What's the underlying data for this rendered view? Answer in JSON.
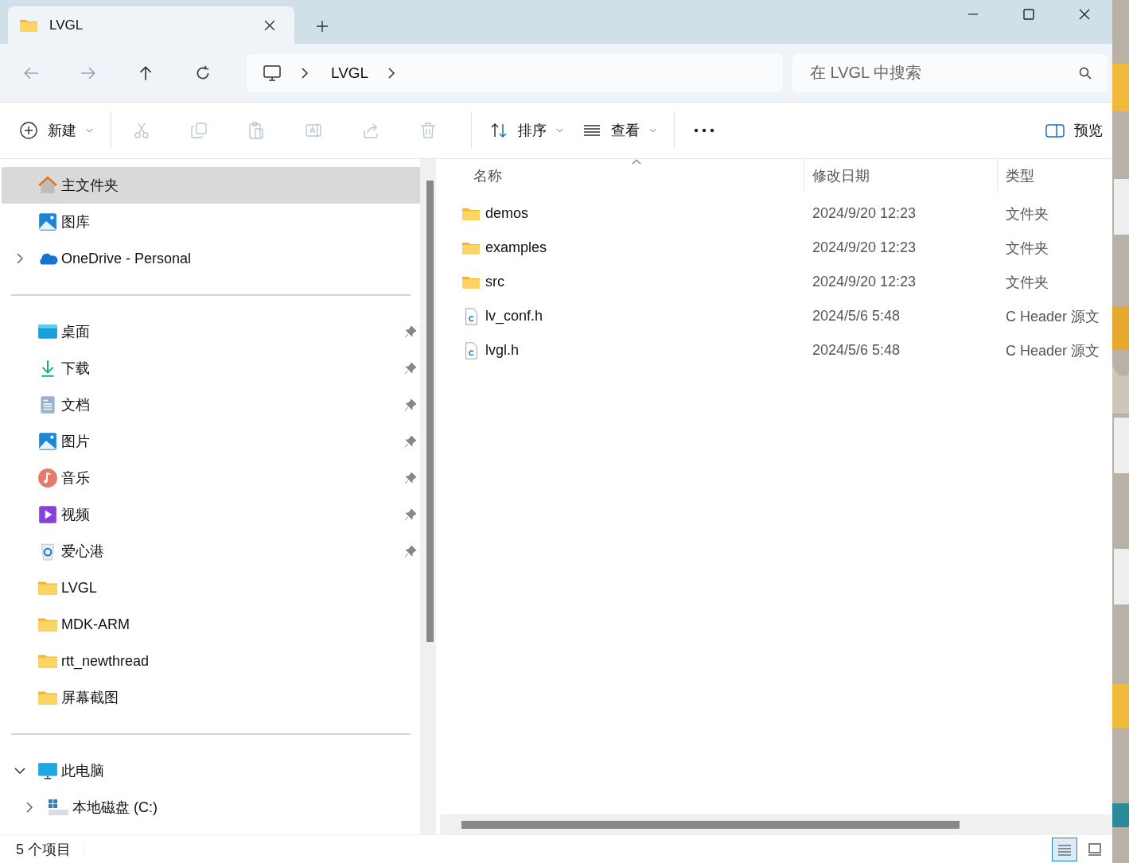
{
  "window": {
    "tab_title": "LVGL"
  },
  "address_bar": {
    "crumbs": [
      "LVGL"
    ]
  },
  "search": {
    "placeholder": "在 LVGL 中搜索"
  },
  "toolbar": {
    "new_label": "新建",
    "actions": [
      {
        "kind": "cut",
        "disabled": true
      },
      {
        "kind": "copy",
        "disabled": true
      },
      {
        "kind": "paste",
        "disabled": true
      },
      {
        "kind": "rename",
        "disabled": true
      },
      {
        "kind": "share",
        "disabled": true
      },
      {
        "kind": "delete",
        "disabled": true
      }
    ],
    "sort_label": "排序",
    "view_label": "查看",
    "preview_label": "预览"
  },
  "sidebar": {
    "groups": [
      {
        "items": [
          {
            "label": "主文件夹",
            "kind": "home",
            "selected": true,
            "pinned": false
          },
          {
            "label": "图库",
            "kind": "gallery",
            "selected": false,
            "pinned": false
          },
          {
            "label": "OneDrive - Personal",
            "kind": "cloud",
            "selected": false,
            "pinned": false,
            "expanded": false
          }
        ]
      },
      {
        "items": [
          {
            "label": "桌面",
            "kind": "desktop",
            "selected": false,
            "pinned": true
          },
          {
            "label": "下载",
            "kind": "download",
            "selected": false,
            "pinned": true
          },
          {
            "label": "文档",
            "kind": "document",
            "selected": false,
            "pinned": true
          },
          {
            "label": "图片",
            "kind": "pictures",
            "selected": false,
            "pinned": true
          },
          {
            "label": "音乐",
            "kind": "music",
            "selected": false,
            "pinned": true
          },
          {
            "label": "视频",
            "kind": "video",
            "selected": false,
            "pinned": true
          },
          {
            "label": "爱心港",
            "kind": "recycle",
            "selected": false,
            "pinned": true
          },
          {
            "label": "LVGL",
            "kind": "folder",
            "selected": false,
            "pinned": false
          },
          {
            "label": "MDK-ARM",
            "kind": "folder",
            "selected": false,
            "pinned": false
          },
          {
            "label": "rtt_newthread",
            "kind": "folder",
            "selected": false,
            "pinned": false
          },
          {
            "label": "屏幕截图",
            "kind": "folder",
            "selected": false,
            "pinned": false
          }
        ]
      },
      {
        "items": [
          {
            "label": "此电脑",
            "kind": "computer",
            "selected": false,
            "pinned": false,
            "expanded": true,
            "children": [
              {
                "label": "本地磁盘 (C:)",
                "kind": "drive",
                "selected": false,
                "pinned": false,
                "expanded": false
              }
            ]
          }
        ]
      }
    ]
  },
  "files": {
    "columns": [
      "名称",
      "修改日期",
      "类型"
    ],
    "sort_ascending": true,
    "rows": [
      {
        "name": "demos",
        "date": "2024/9/20 12:23",
        "type": "文件夹",
        "kind": "folder",
        "selected": false
      },
      {
        "name": "examples",
        "date": "2024/9/20 12:23",
        "type": "文件夹",
        "kind": "folder",
        "selected": false
      },
      {
        "name": "src",
        "date": "2024/9/20 12:23",
        "type": "文件夹",
        "kind": "folder",
        "selected": false
      },
      {
        "name": "lv_conf.h",
        "date": "2024/5/6 5:48",
        "type": "C Header 源文",
        "kind": "cheader",
        "selected": false
      },
      {
        "name": "lvgl.h",
        "date": "2024/5/6 5:48",
        "type": "C Header 源文",
        "kind": "cheader",
        "selected": false
      }
    ]
  },
  "status_bar": {
    "count": "5 个项目",
    "views": [
      {
        "kind": "details",
        "selected": true
      },
      {
        "kind": "tiles",
        "selected": false
      }
    ]
  }
}
